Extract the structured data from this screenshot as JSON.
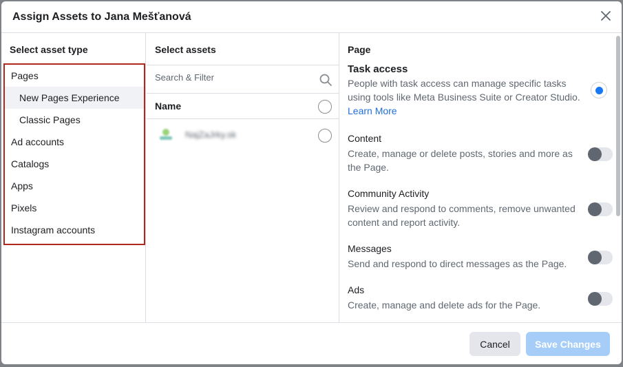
{
  "dialog": {
    "title": "Assign Assets to Jana Mešťanová"
  },
  "asset_types": {
    "heading": "Select asset type",
    "items": [
      {
        "label": "Pages",
        "sub": false,
        "active": false
      },
      {
        "label": "New Pages Experience",
        "sub": true,
        "active": true
      },
      {
        "label": "Classic Pages",
        "sub": true,
        "active": false
      },
      {
        "label": "Ad accounts",
        "sub": false,
        "active": false
      },
      {
        "label": "Catalogs",
        "sub": false,
        "active": false
      },
      {
        "label": "Apps",
        "sub": false,
        "active": false
      },
      {
        "label": "Pixels",
        "sub": false,
        "active": false
      },
      {
        "label": "Instagram accounts",
        "sub": false,
        "active": false
      }
    ]
  },
  "assets": {
    "heading": "Select assets",
    "search_placeholder": "Search & Filter",
    "name_header": "Name",
    "rows": [
      {
        "name": "NajZaJrky.sk"
      }
    ]
  },
  "permissions": {
    "heading": "Page",
    "task_access": {
      "title": "Task access",
      "desc": "People with task access can manage specific tasks using tools like Meta Business Suite or Creator Studio.",
      "link": "Learn More",
      "selected": true
    },
    "items": [
      {
        "title": "Content",
        "desc": "Create, manage or delete posts, stories and more as the Page.",
        "on": false
      },
      {
        "title": "Community Activity",
        "desc": "Review and respond to comments, remove unwanted content and report activity.",
        "on": false
      },
      {
        "title": "Messages",
        "desc": "Send and respond to direct messages as the Page.",
        "on": false
      },
      {
        "title": "Ads",
        "desc": "Create, manage and delete ads for the Page.",
        "on": false
      }
    ]
  },
  "footer": {
    "cancel_label": "Cancel",
    "save_label": "Save Changes"
  },
  "colors": {
    "accent": "#1877f2",
    "highlight_border": "#b3261e",
    "save_disabled": "#a6cdf8",
    "link": "#216fdb"
  },
  "icons": {
    "close": "close-icon",
    "search": "search-icon",
    "page_thumbnail": "page-thumbnail-icon"
  }
}
